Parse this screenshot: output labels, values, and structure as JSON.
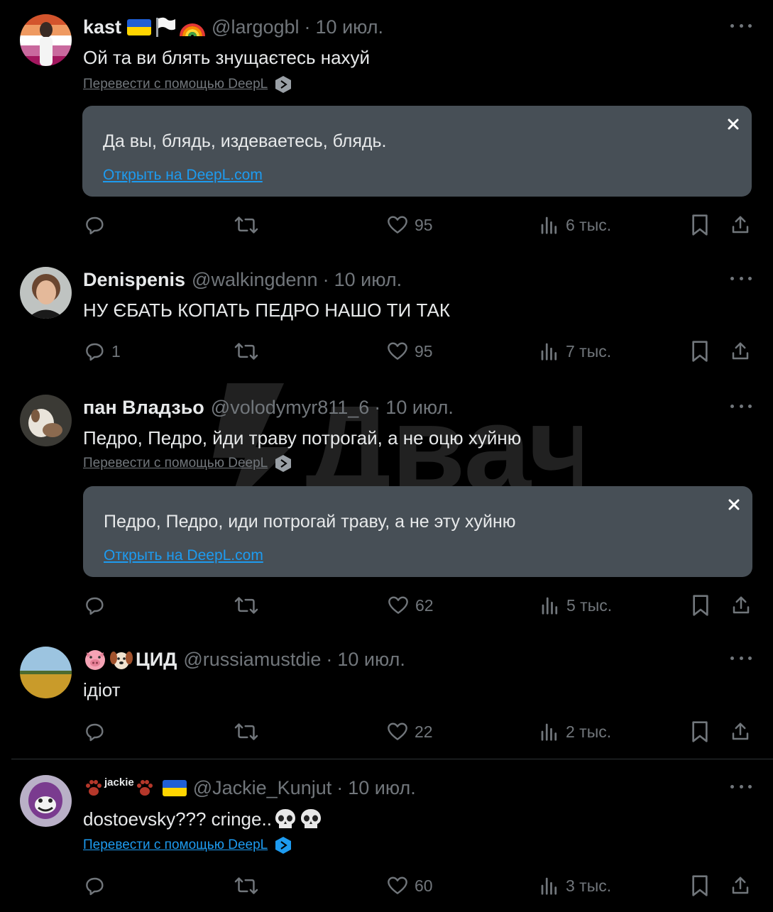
{
  "watermark": "Двач",
  "tweets": [
    {
      "name": "kast",
      "handle": "@largogbl",
      "separator": "·",
      "time": "10 июл.",
      "text": "Ой та ви блять знущаєтесь нахуй",
      "translate_label": "Перевести с помощью DeepL",
      "translation": "Да вы, блядь, издеваетесь, блядь.",
      "open_link": "Открыть на DeepL.com",
      "stats": {
        "replies": "",
        "reposts": "",
        "likes": "95",
        "views": "6 тыс."
      }
    },
    {
      "name": "Denispenis",
      "handle": "@walkingdenn",
      "separator": "·",
      "time": "10 июл.",
      "text": "НУ ЄБАТЬ КОПАТЬ ПЕДРО НАШО ТИ ТАК",
      "stats": {
        "replies": "1",
        "reposts": "",
        "likes": "95",
        "views": "7 тыс."
      }
    },
    {
      "name": "пан Владзьо",
      "handle": "@volodymyr811_6",
      "separator": "·",
      "time": "10 июл.",
      "text": "Педро, Педро, йди траву потрогай, а не оцю хуйню",
      "translate_label": "Перевести с помощью DeepL",
      "translation": "Педро, Педро, иди потрогай траву, а не эту хуйню",
      "open_link": "Открыть на DeepL.com",
      "stats": {
        "replies": "",
        "reposts": "",
        "likes": "62",
        "views": "5 тыс."
      }
    },
    {
      "name": "ЦИД",
      "handle": "@russiamustdie",
      "separator": "·",
      "time": "10 июл.",
      "text": "ідіот",
      "stats": {
        "replies": "",
        "reposts": "",
        "likes": "22",
        "views": "2 тыс."
      }
    },
    {
      "name": "jackie",
      "handle": "@Jackie_Kunjut",
      "separator": "·",
      "time": "10 июл.",
      "text": "dostoevsky??? cringe..",
      "translate_label": "Перевести с помощью DeepL",
      "stats": {
        "replies": "",
        "reposts": "",
        "likes": "60",
        "views": "3 тыс."
      }
    }
  ],
  "colors": {
    "background": "#000000",
    "text": "#e7e9ea",
    "muted": "#71767b",
    "link": "#1d9bf0",
    "translation_box": "#474f56"
  }
}
